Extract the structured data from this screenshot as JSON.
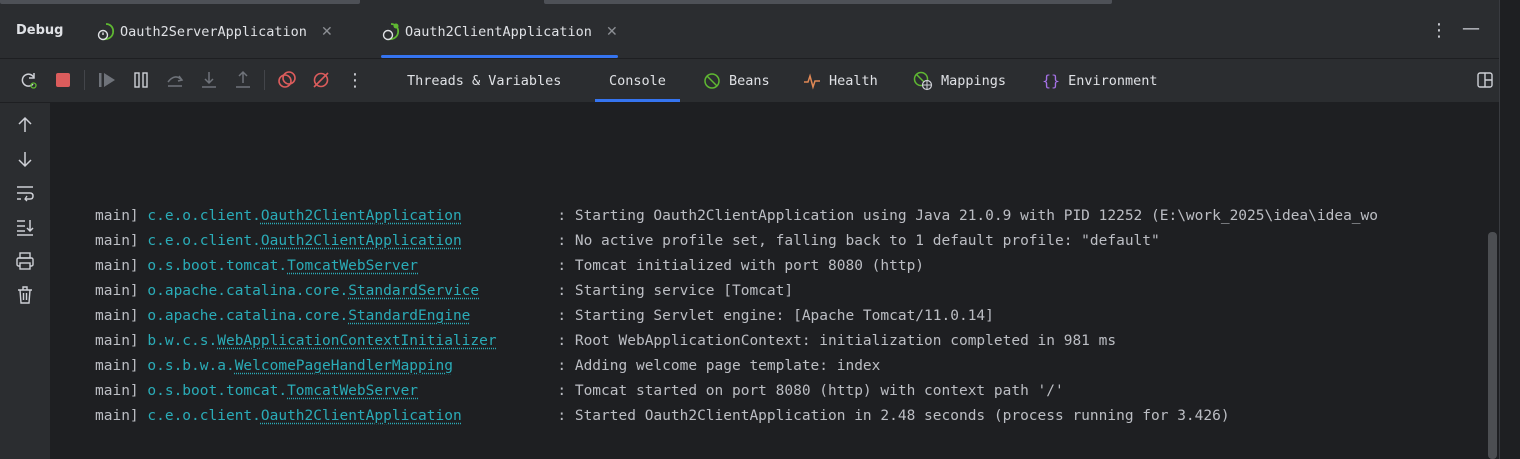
{
  "colors": {
    "accent": "#3574f0",
    "logger": "#2aacb8",
    "text": "#bcbec4",
    "bg_console": "#1e1f22",
    "bg_panel": "#2b2d30"
  },
  "header": {
    "title": "Debug",
    "tabs": [
      {
        "label": "Oauth2ServerApplication",
        "icon": "spring-boot-run-icon",
        "active": false
      },
      {
        "label": "Oauth2ClientApplication",
        "icon": "spring-boot-run-icon",
        "active": true
      }
    ],
    "right_icons": [
      "more-vertical-icon",
      "minimize-icon"
    ]
  },
  "toolbar": {
    "icons": [
      "rerun-icon",
      "stop-icon",
      "resume-icon",
      "pause-icon",
      "step-over-icon",
      "step-into-icon",
      "step-out-icon",
      "view-breakpoints-icon",
      "mute-breakpoints-icon",
      "more-vertical-icon"
    ],
    "view_tabs": [
      {
        "label": "Threads & Variables",
        "icon": null,
        "active": false
      },
      {
        "label": "Console",
        "icon": null,
        "active": true
      },
      {
        "label": "Beans",
        "icon": "beans-icon",
        "active": false
      },
      {
        "label": "Health",
        "icon": "health-icon",
        "active": false
      },
      {
        "label": "Mappings",
        "icon": "mappings-icon",
        "active": false
      },
      {
        "label": "Environment",
        "icon": "environment-icon",
        "active": false
      }
    ],
    "layout_icon": "layout-icon"
  },
  "sidebar": {
    "icons": [
      "scroll-up-icon",
      "scroll-down-icon",
      "soft-wrap-icon",
      "scroll-to-end-icon",
      "print-icon",
      "clear-all-icon"
    ]
  },
  "console": {
    "lines": [
      {
        "thread": "main]",
        "pkg": "c.e.o.client.",
        "cls": "Oauth2ClientApplication",
        "msg": ": Starting Oauth2ClientApplication using Java 21.0.9 with PID 12252 (E:\\work_2025\\idea\\idea_wo"
      },
      {
        "thread": "main]",
        "pkg": "c.e.o.client.",
        "cls": "Oauth2ClientApplication",
        "msg": ": No active profile set, falling back to 1 default profile: \"default\""
      },
      {
        "thread": "main]",
        "pkg": "o.s.boot.tomcat.",
        "cls": "TomcatWebServer",
        "msg": ": Tomcat initialized with port 8080 (http)"
      },
      {
        "thread": "main]",
        "pkg": "o.apache.catalina.core.",
        "cls": "StandardService",
        "msg": ": Starting service [Tomcat]"
      },
      {
        "thread": "main]",
        "pkg": "o.apache.catalina.core.",
        "cls": "StandardEngine",
        "msg": ": Starting Servlet engine: [Apache Tomcat/11.0.14]"
      },
      {
        "thread": "main]",
        "pkg": "b.w.c.s.",
        "cls": "WebApplicationContextInitializer",
        "msg": ": Root WebApplicationContext: initialization completed in 981 ms"
      },
      {
        "thread": "main]",
        "pkg": "o.s.b.w.a.",
        "cls": "WelcomePageHandlerMapping",
        "msg": ": Adding welcome page template: index"
      },
      {
        "thread": "main]",
        "pkg": "o.s.boot.tomcat.",
        "cls": "TomcatWebServer",
        "msg": ": Tomcat started on port 8080 (http) with context path '/'"
      },
      {
        "thread": "main]",
        "pkg": "c.e.o.client.",
        "cls": "Oauth2ClientApplication",
        "msg": ": Started Oauth2ClientApplication in 2.48 seconds (process running for 3.426)"
      }
    ]
  }
}
